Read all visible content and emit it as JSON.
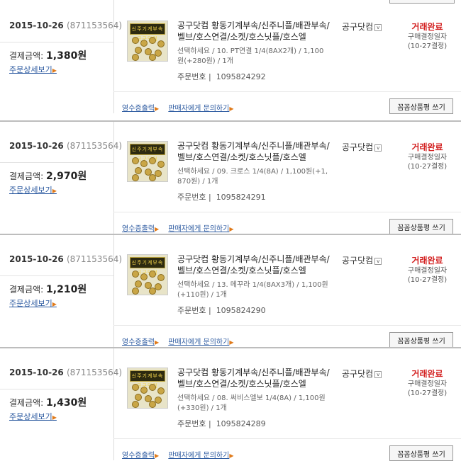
{
  "orders": [
    {
      "date": "2015-10-26",
      "order_id": "(871153564)",
      "pay_label": "결제금액:",
      "pay_amount": "1,380원",
      "detail_link": "주문상세보기",
      "product_name": "공구닷컴 황동기계부속/신주니플/배관부속/벨브/호스연결/소켓/호스닛플/호스엘",
      "option": "선택하세요 / 10. PT연결 1/4(8AX2개) / 1,100원(+280원) / 1개",
      "product_no_label": "주문번호 |",
      "product_no": "1095824292",
      "seller": "공구닷컴",
      "status": "거래완료",
      "status_sub": "구매결정일자",
      "status_date": "(10-27결정)",
      "receipt_link": "영수증출력",
      "inquiry_link": "판매자에게 문의하기",
      "review_button": "꼼꼼상품평 쓰기"
    },
    {
      "date": "2015-10-26",
      "order_id": "(871153564)",
      "pay_label": "결제금액:",
      "pay_amount": "2,970원",
      "detail_link": "주문상세보기",
      "product_name": "공구닷컴 황동기계부속/신주니플/배관부속/벨브/호스연결/소켓/호스닛플/호스엘",
      "option": "선택하세요 / 09. 크로스 1/4(8A) / 1,100원(+1,870원) / 1개",
      "product_no_label": "주문번호 |",
      "product_no": "1095824291",
      "seller": "공구닷컴",
      "status": "거래완료",
      "status_sub": "구매결정일자",
      "status_date": "(10-27결정)",
      "receipt_link": "영수증출력",
      "inquiry_link": "판매자에게 문의하기",
      "review_button": "꼼꼼상품평 쓰기"
    },
    {
      "date": "2015-10-26",
      "order_id": "(871153564)",
      "pay_label": "결제금액:",
      "pay_amount": "1,210원",
      "detail_link": "주문상세보기",
      "product_name": "공구닷컴 황동기계부속/신주니플/배관부속/벨브/호스연결/소켓/호스닛플/호스엘",
      "option": "선택하세요 / 13. 메꾸라 1/4(8AX3개) / 1,100원(+110원) / 1개",
      "product_no_label": "주문번호 |",
      "product_no": "1095824290",
      "seller": "공구닷컴",
      "status": "거래완료",
      "status_sub": "구매결정일자",
      "status_date": "(10-27결정)",
      "receipt_link": "영수증출력",
      "inquiry_link": "판매자에게 문의하기",
      "review_button": "꼼꼼상품평 쓰기"
    },
    {
      "date": "2015-10-26",
      "order_id": "(871153564)",
      "pay_label": "결제금액:",
      "pay_amount": "1,430원",
      "detail_link": "주문상세보기",
      "product_name": "공구닷컴 황동기계부속/신주니플/배관부속/벨브/호스연결/소켓/호스닛플/호스엘",
      "option": "선택하세요 / 08. 써비스엘보 1/4(8A) / 1,100원(+330원) / 1개",
      "product_no_label": "주문번호 |",
      "product_no": "1095824289",
      "seller": "공구닷컴",
      "status": "거래완료",
      "status_sub": "구매결정일자",
      "status_date": "(10-27결정)",
      "receipt_link": "영수증출력",
      "inquiry_link": "판매자에게 문의하기",
      "review_button": "꼼꼼상품평 쓰기"
    }
  ],
  "thumbnail_text": "신주기계부속 공구닷컴",
  "colors": {
    "status": "#d32020",
    "link": "#2c5aa0",
    "arrow": "#e07a1a"
  },
  "icons": {
    "seller_dropdown": "chevron-down-icon",
    "link_arrow": "right-triangle-icon"
  }
}
